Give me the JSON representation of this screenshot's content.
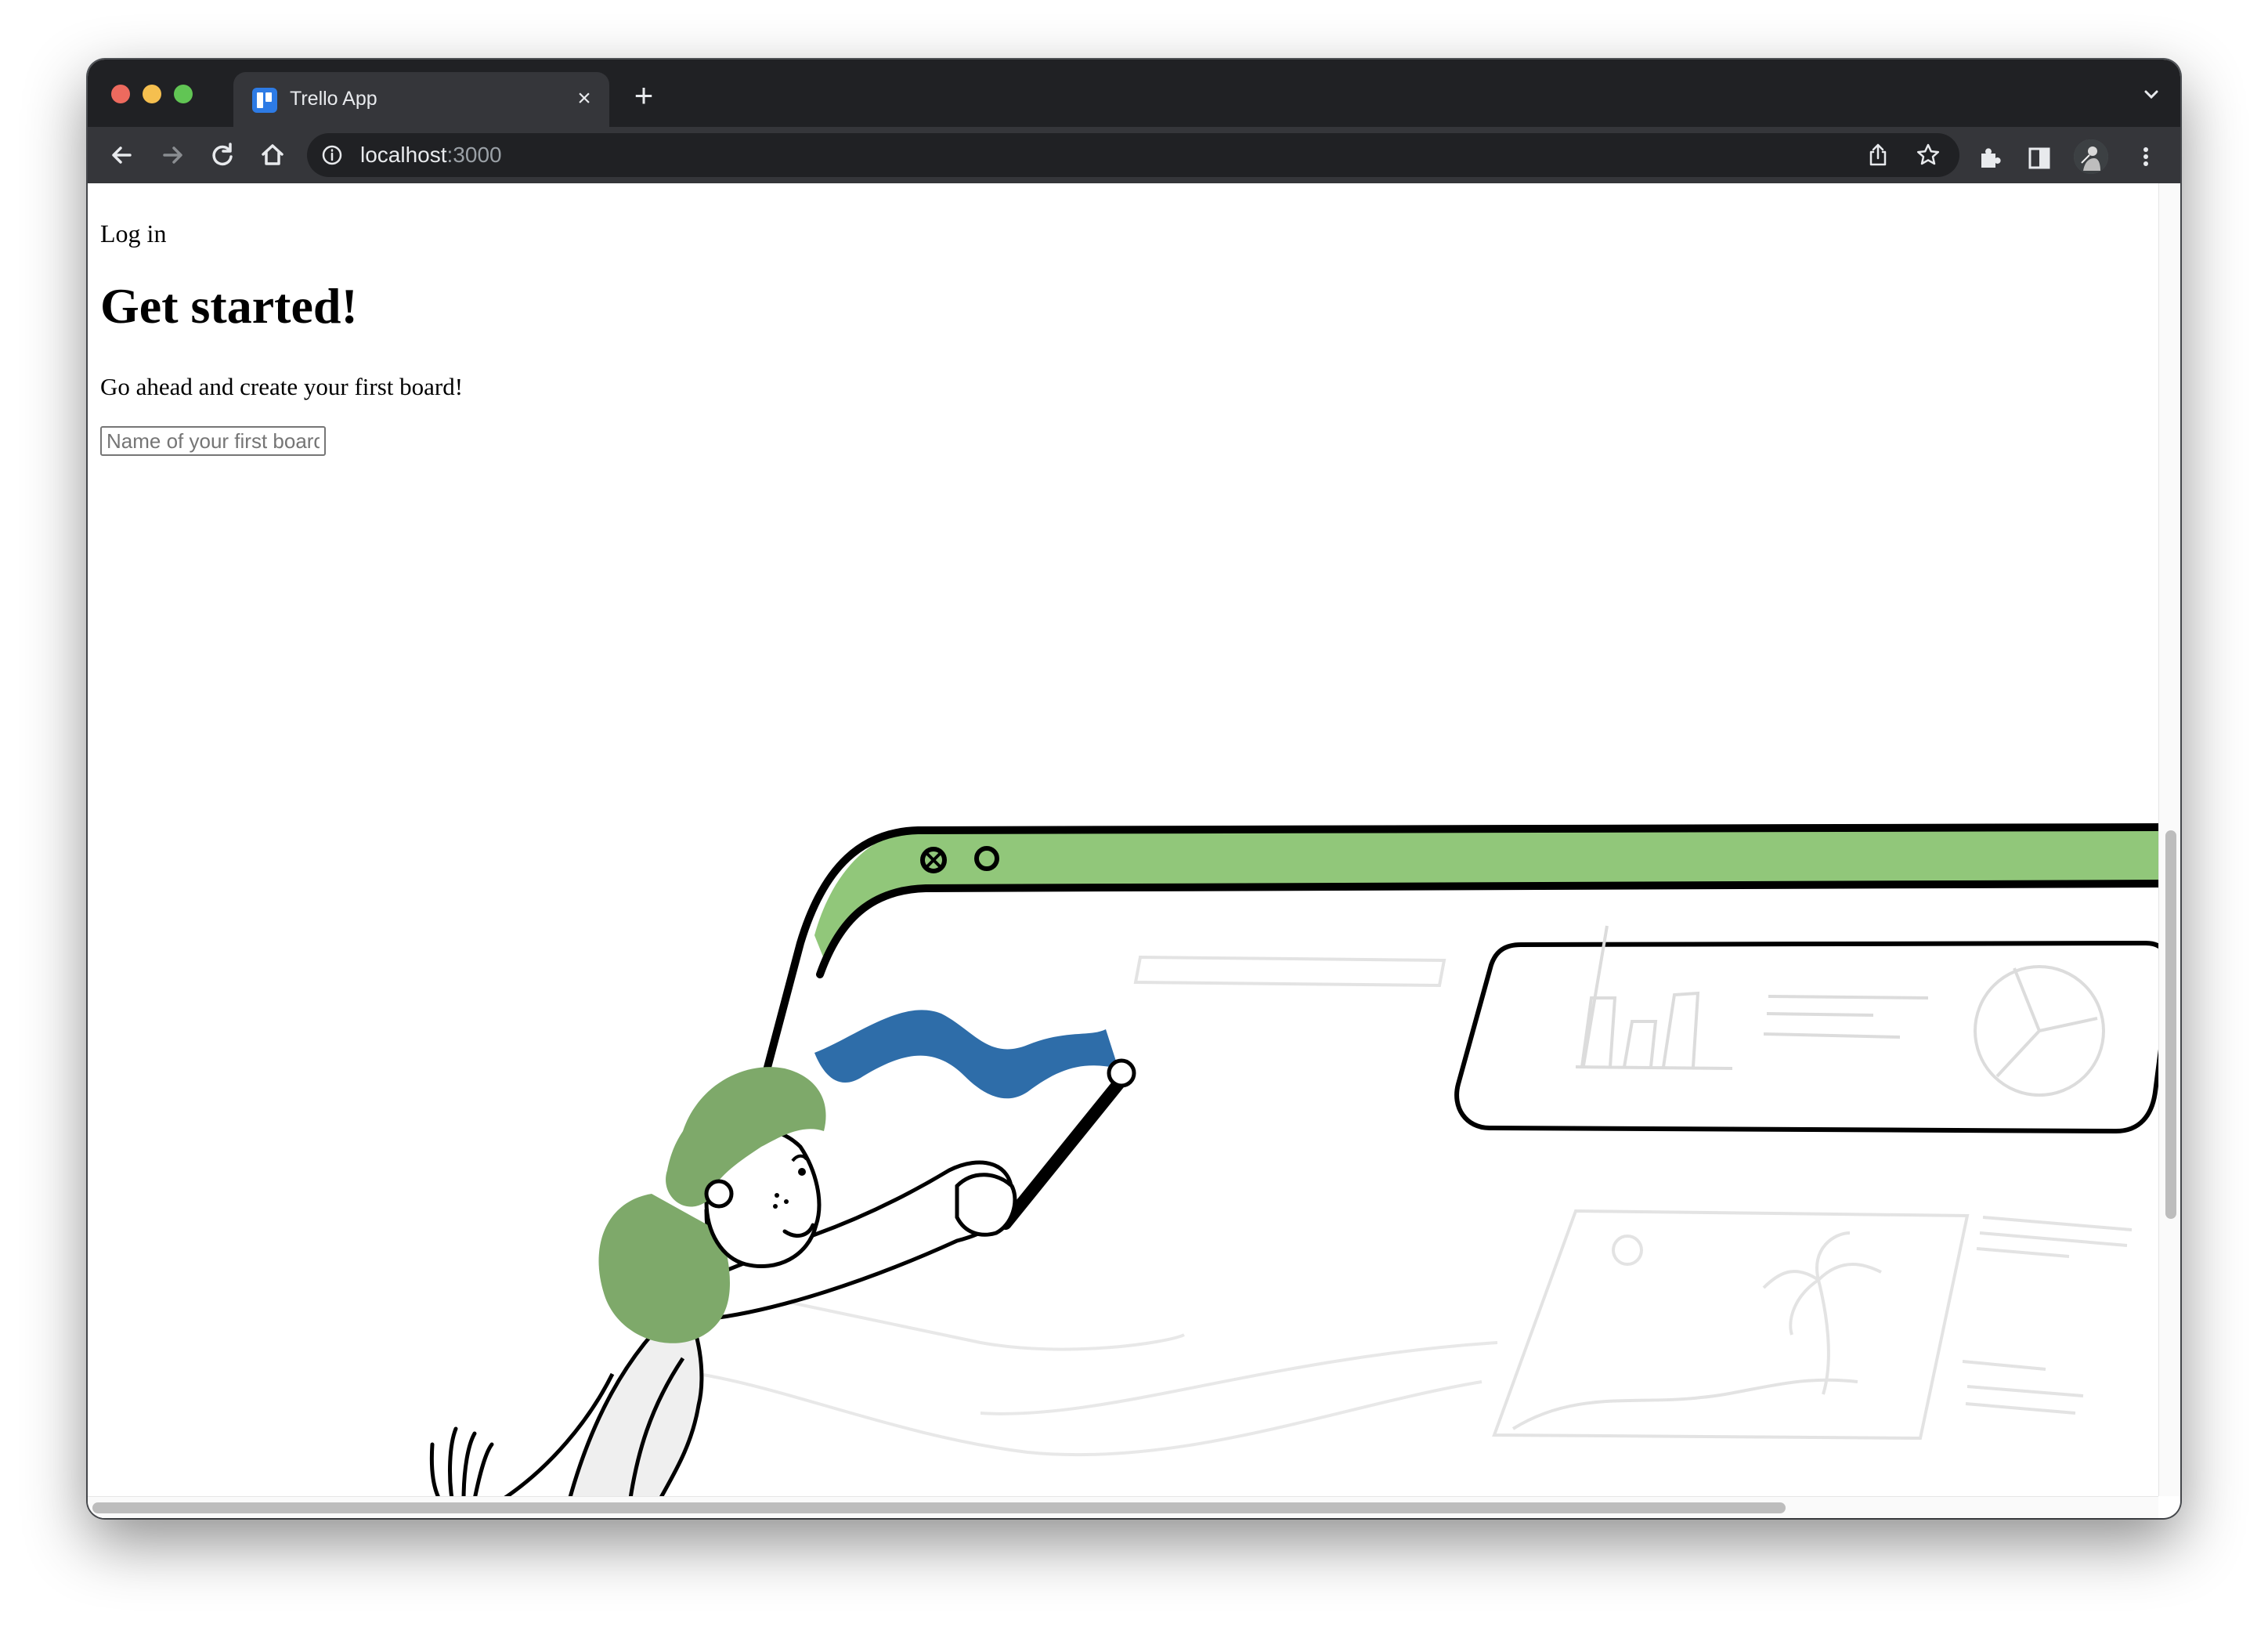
{
  "browser": {
    "tab": {
      "title": "Trello App",
      "favicon": "trello-icon",
      "close_icon": "close-icon"
    },
    "new_tab_icon": "plus-icon",
    "tab_menu_icon": "chevron-down-icon",
    "address": {
      "host": "localhost",
      "port": ":3000"
    },
    "colors": {
      "chrome_dark": "#202124",
      "chrome_mid": "#35363a",
      "close": "#ed6a5e",
      "minimize": "#f5bf4f",
      "zoom": "#61c554"
    }
  },
  "page": {
    "login_label": "Log in",
    "heading": "Get started!",
    "subtext": "Go ahead and create your first board!",
    "board_input": {
      "placeholder": "Name of your first board",
      "value": ""
    }
  },
  "illustration": {
    "accent_green": "#91c77a",
    "hair_green": "#7ea96a",
    "flag_blue": "#2e6da9"
  }
}
